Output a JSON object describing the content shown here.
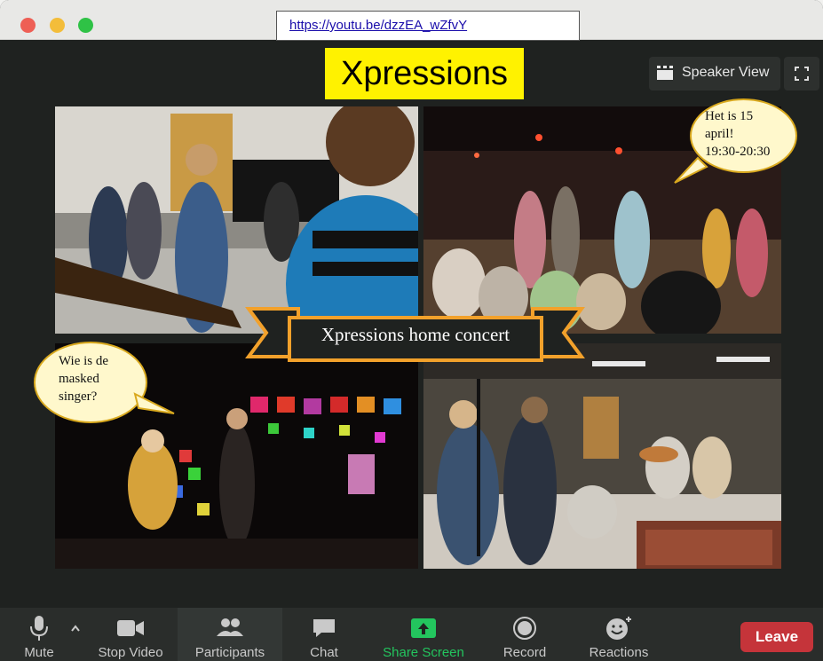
{
  "window": {
    "url": "https://youtu.be/dzzEA_wZfvY",
    "banner": "Xpressions",
    "speaker_view_label": "Speaker View"
  },
  "overlay": {
    "ribbon_text": "Xpressions home concert",
    "bubble_date_line1": "Het is 15",
    "bubble_date_line2": "april!",
    "bubble_date_line3": "19:30-20:30",
    "bubble_masked_line1": "Wie is de",
    "bubble_masked_line2": "masked",
    "bubble_masked_line3": "singer?"
  },
  "toolbar": {
    "mute": "Mute",
    "stop_video": "Stop Video",
    "participants": "Participants",
    "chat": "Chat",
    "share_screen": "Share Screen",
    "record": "Record",
    "reactions": "Reactions",
    "leave": "Leave"
  },
  "colors": {
    "accent_green": "#23c55e",
    "leave_red": "#c5343a",
    "banner_yellow": "#fff200",
    "ribbon_orange": "#f2a12b"
  },
  "icons": [
    "microphone-icon",
    "caret-up-icon",
    "video-camera-icon",
    "participants-icon",
    "chat-icon",
    "share-screen-icon",
    "record-icon",
    "reactions-icon",
    "grid-icon",
    "fullscreen-icon"
  ]
}
